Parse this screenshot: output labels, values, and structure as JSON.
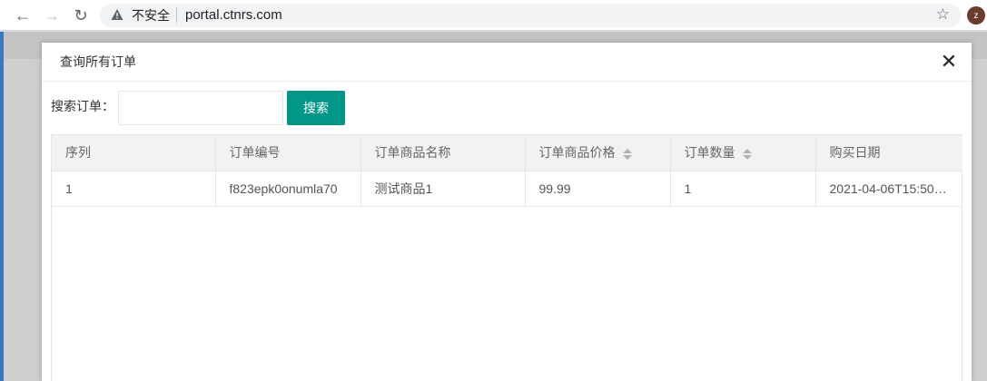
{
  "browser": {
    "insecure_label": "不安全",
    "url": "portal.ctnrs.com",
    "avatar_letter": "z"
  },
  "modal": {
    "title": "查询所有订单",
    "search_label": "搜索订单：",
    "search_value": "",
    "search_button": "搜索"
  },
  "table": {
    "columns": [
      {
        "label": "序列",
        "sortable": false
      },
      {
        "label": "订单编号",
        "sortable": false
      },
      {
        "label": "订单商品名称",
        "sortable": false
      },
      {
        "label": "订单商品价格",
        "sortable": true
      },
      {
        "label": "订单数量",
        "sortable": true
      },
      {
        "label": "购买日期",
        "sortable": false
      }
    ],
    "rows": [
      [
        "1",
        "f823epk0onumla70",
        "测试商品1",
        "99.99",
        "1",
        "2021-04-06T15:50…"
      ]
    ]
  },
  "colors": {
    "accent": "#009688",
    "header_bg": "#f2f2f2"
  }
}
